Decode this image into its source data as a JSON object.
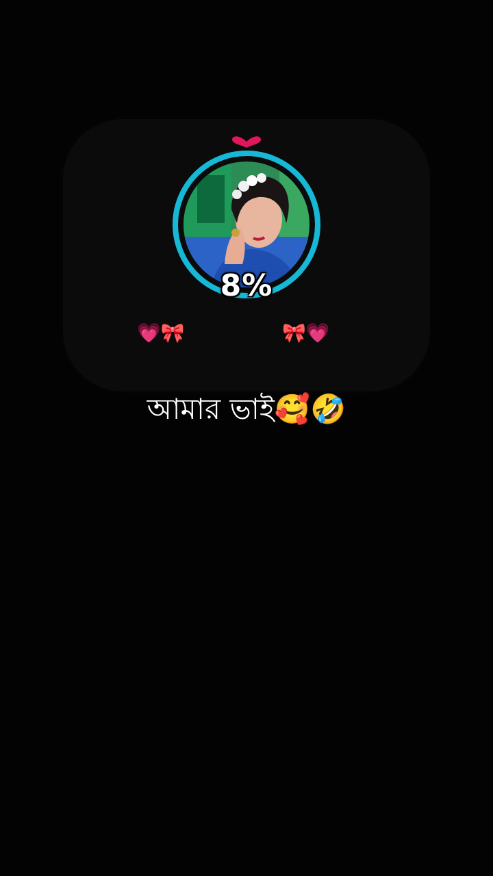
{
  "widget": {
    "progress_text": "8%",
    "progress_value": 8,
    "ring_color": "#17b8d6",
    "heart_color": "#e0175a",
    "left_emojis": "💗🎀",
    "right_emojis": "🎀💗"
  },
  "caption": {
    "text": "আমার ভাই🥰🤣"
  },
  "icons": {
    "top": "heart-icon",
    "avatar": "profile-photo"
  }
}
